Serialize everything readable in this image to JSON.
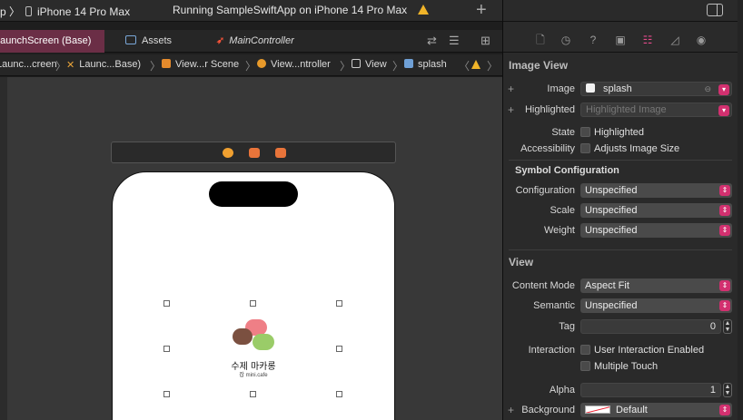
{
  "toolbar": {
    "scheme_prefix": "p 〉",
    "device": "iPhone 14 Pro Max",
    "status": "Running SampleSwiftApp on iPhone 14 Pro Max"
  },
  "tabs": {
    "launch": "LaunchScreen (Base)",
    "assets": "Assets",
    "main": "MainController"
  },
  "jumpbar": {
    "items": [
      "Launc...creen",
      "Launc...Base)",
      "View...r Scene",
      "View...ntroller",
      "View",
      "splash"
    ]
  },
  "canvas": {
    "splash_title": "수제 마카롱",
    "splash_subtitle": "잡 mini.cafe"
  },
  "inspector": {
    "image_view_header": "Image View",
    "image_label": "Image",
    "image_value": "splash",
    "highlighted_label": "Highlighted",
    "highlighted_placeholder": "Highlighted Image",
    "state_label": "State",
    "state_checkbox": "Highlighted",
    "accessibility_label": "Accessibility",
    "accessibility_checkbox": "Adjusts Image Size",
    "symbol_header": "Symbol Configuration",
    "configuration_label": "Configuration",
    "configuration_value": "Unspecified",
    "scale_label": "Scale",
    "scale_value": "Unspecified",
    "weight_label": "Weight",
    "weight_value": "Unspecified",
    "view_header": "View",
    "content_mode_label": "Content Mode",
    "content_mode_value": "Aspect Fit",
    "semantic_label": "Semantic",
    "semantic_value": "Unspecified",
    "tag_label": "Tag",
    "tag_value": "0",
    "interaction_label": "Interaction",
    "interaction_checkbox": "User Interaction Enabled",
    "multitouch_checkbox": "Multiple Touch",
    "alpha_label": "Alpha",
    "alpha_value": "1",
    "background_label": "Background",
    "background_value": "Default"
  },
  "colors": {
    "accent_pink": "#d2306f",
    "active_tab": "#6b2e46"
  }
}
